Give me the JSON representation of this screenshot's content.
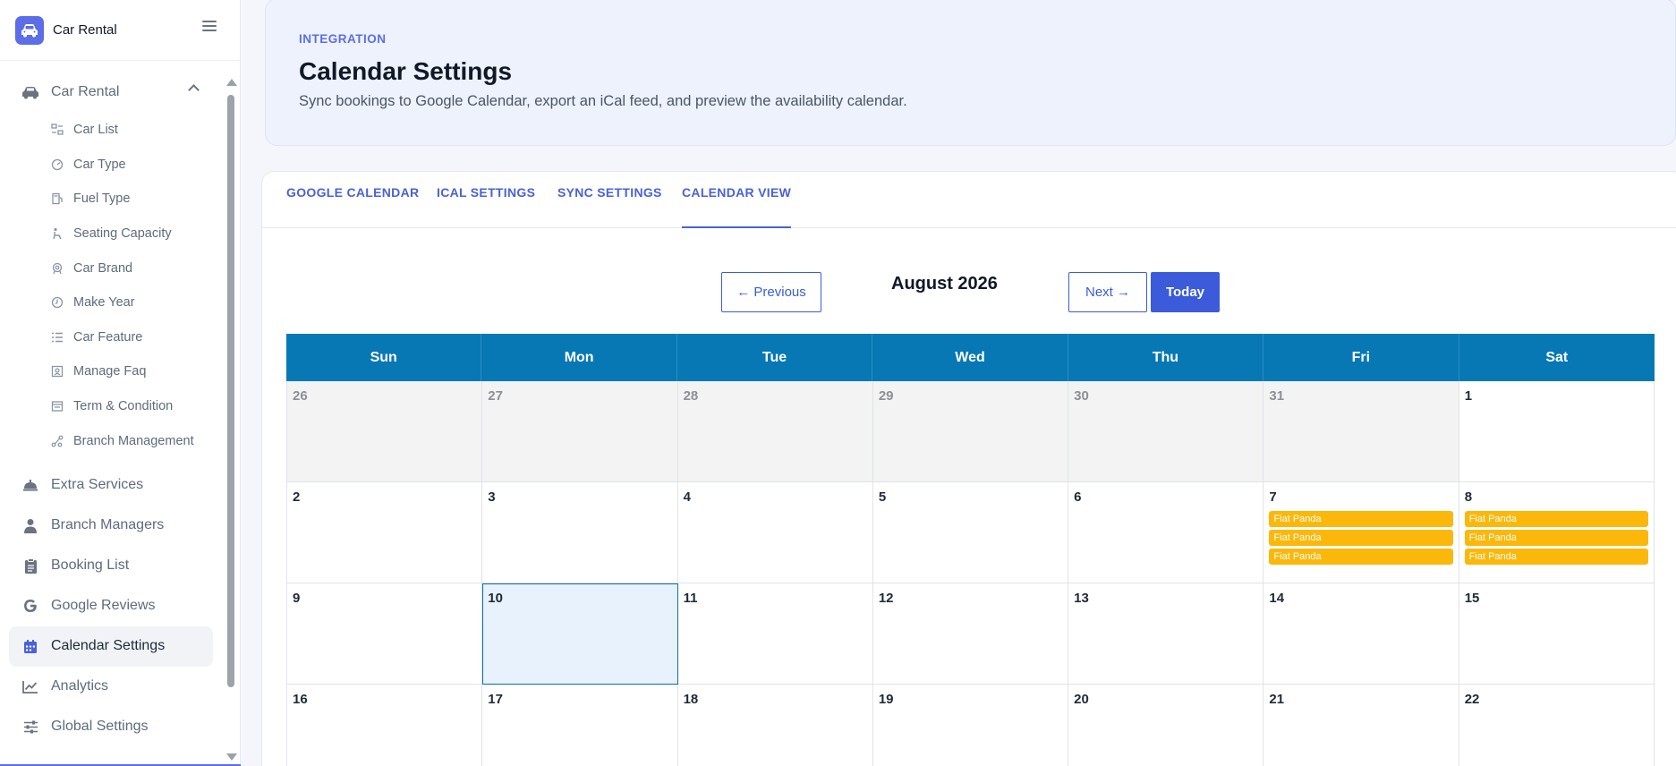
{
  "brand": {
    "name": "Car Rental"
  },
  "sidebar": {
    "group": {
      "label": "Car Rental",
      "icon": "car-icon"
    },
    "sub_items": [
      {
        "label": "Car List",
        "icon": "list-icon"
      },
      {
        "label": "Car Type",
        "icon": "gauge-icon"
      },
      {
        "label": "Fuel Type",
        "icon": "fuel-icon"
      },
      {
        "label": "Seating Capacity",
        "icon": "seat-icon"
      },
      {
        "label": "Car Brand",
        "icon": "badge-icon"
      },
      {
        "label": "Make Year",
        "icon": "clock-icon"
      },
      {
        "label": "Car Feature",
        "icon": "feature-list-icon"
      },
      {
        "label": "Manage Faq",
        "icon": "faq-icon"
      },
      {
        "label": "Term & Condition",
        "icon": "document-icon"
      },
      {
        "label": "Branch Management",
        "icon": "branch-icon"
      }
    ],
    "main_items": [
      {
        "label": "Extra Services",
        "icon": "bell-icon"
      },
      {
        "label": "Branch Managers",
        "icon": "user-icon"
      },
      {
        "label": "Booking List",
        "icon": "clipboard-icon"
      },
      {
        "label": "Google Reviews",
        "icon": "google-icon"
      },
      {
        "label": "Calendar Settings",
        "icon": "calendar-icon",
        "active": true
      },
      {
        "label": "Analytics",
        "icon": "chart-icon"
      },
      {
        "label": "Global Settings",
        "icon": "sliders-icon"
      }
    ]
  },
  "header": {
    "eyebrow": "INTEGRATION",
    "title": "Calendar Settings",
    "subtitle": "Sync bookings to Google Calendar, export an iCal feed, and preview the availability calendar."
  },
  "tabs": [
    {
      "label": "GOOGLE CALENDAR"
    },
    {
      "label": "ICAL SETTINGS"
    },
    {
      "label": "SYNC SETTINGS"
    },
    {
      "label": "CALENDAR VIEW",
      "active": true
    }
  ],
  "calendar": {
    "prev_label": "← Previous",
    "next_label": "Next →",
    "today_label": "Today",
    "month_title": "August 2026",
    "weekdays": [
      "Sun",
      "Mon",
      "Tue",
      "Wed",
      "Thu",
      "Fri",
      "Sat"
    ],
    "weeks": [
      [
        {
          "day": "26",
          "other": true
        },
        {
          "day": "27",
          "other": true
        },
        {
          "day": "28",
          "other": true
        },
        {
          "day": "29",
          "other": true
        },
        {
          "day": "30",
          "other": true
        },
        {
          "day": "31",
          "other": true
        },
        {
          "day": "1"
        }
      ],
      [
        {
          "day": "2"
        },
        {
          "day": "3"
        },
        {
          "day": "4"
        },
        {
          "day": "5"
        },
        {
          "day": "6"
        },
        {
          "day": "7",
          "events": [
            "Fiat Panda",
            "Fiat Panda",
            "Fiat Panda"
          ]
        },
        {
          "day": "8",
          "events": [
            "Fiat Panda",
            "Fiat Panda",
            "Fiat Panda"
          ]
        }
      ],
      [
        {
          "day": "9"
        },
        {
          "day": "10",
          "today": true
        },
        {
          "day": "11"
        },
        {
          "day": "12"
        },
        {
          "day": "13"
        },
        {
          "day": "14"
        },
        {
          "day": "15"
        }
      ],
      [
        {
          "day": "16"
        },
        {
          "day": "17"
        },
        {
          "day": "18"
        },
        {
          "day": "19"
        },
        {
          "day": "20"
        },
        {
          "day": "21"
        },
        {
          "day": "22"
        }
      ]
    ]
  },
  "colors": {
    "accent": "#3b5bdb",
    "calendar_header": "#0878b4",
    "event": "#fbb80b",
    "today_bg": "#e8f2fd"
  }
}
